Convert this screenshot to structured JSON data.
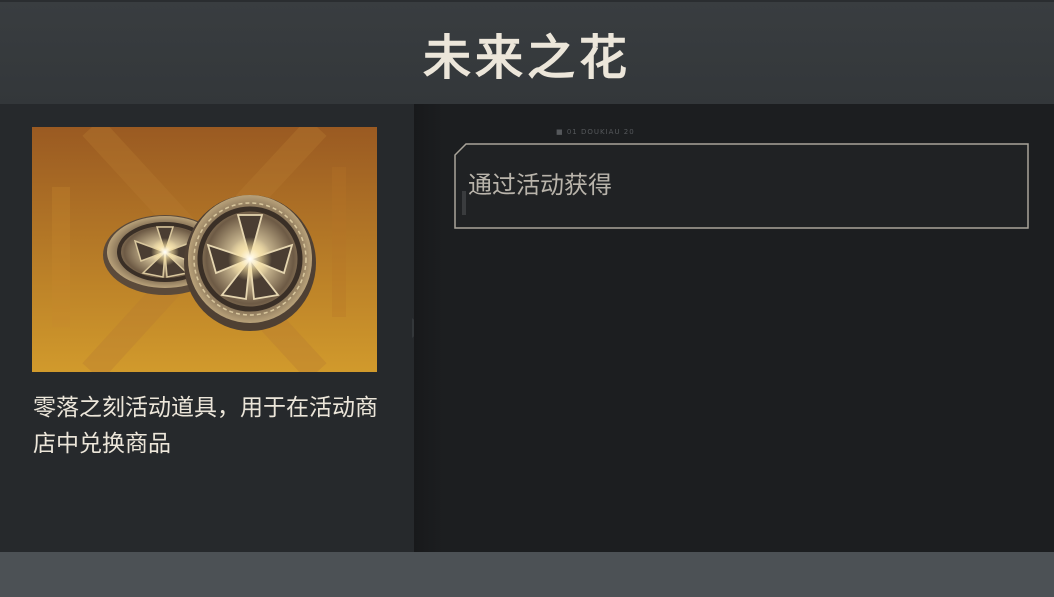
{
  "header": {
    "title": "未来之花"
  },
  "item": {
    "image_name": "flower-of-future-coin-icon",
    "description": "零落之刻活动道具，用于在活动商店中兑换商品"
  },
  "source": {
    "label": "通过活动获得",
    "tag": "■ 01 DOUKIAU 20"
  },
  "colors": {
    "header_bg": "#393d40",
    "left_panel_bg": "#26292c",
    "right_panel_bg": "#1c1e20",
    "footer_bg": "#4c5155",
    "text_primary": "#ece6da",
    "text_secondary": "#b9b4ab",
    "image_bg_top": "#9a5a22",
    "image_bg_bottom": "#d19a2c"
  }
}
